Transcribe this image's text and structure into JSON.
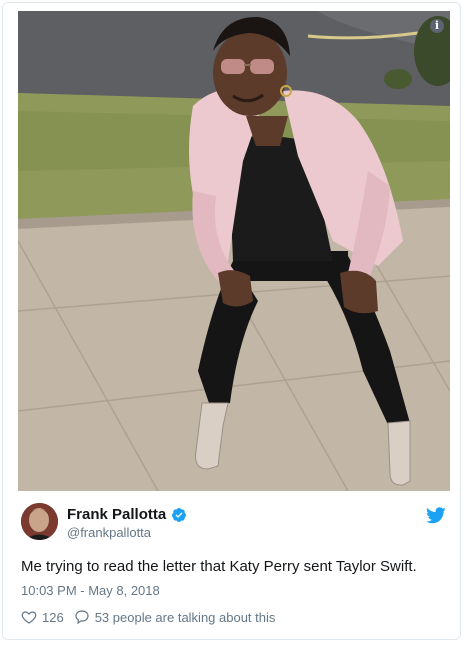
{
  "tweet": {
    "author_name": "Frank Pallotta",
    "author_handle": "@frankpallotta",
    "verified": true,
    "text": "Me trying to read the letter that Katy Perry sent Taylor Swift.",
    "timestamp": "10:03 PM - May 8, 2018",
    "likes": "126",
    "talking": "53 people are talking about this"
  },
  "media": {
    "info_glyph": "i"
  },
  "colors": {
    "brand_blue": "#1da1f2",
    "secondary_text": "#657786",
    "primary_text": "#14171a",
    "border": "#e1e8ed"
  },
  "icons": {
    "info": "info-icon",
    "verified": "verified-badge-icon",
    "brand": "twitter-bird-icon",
    "like": "heart-icon",
    "reply": "speech-bubble-icon"
  }
}
